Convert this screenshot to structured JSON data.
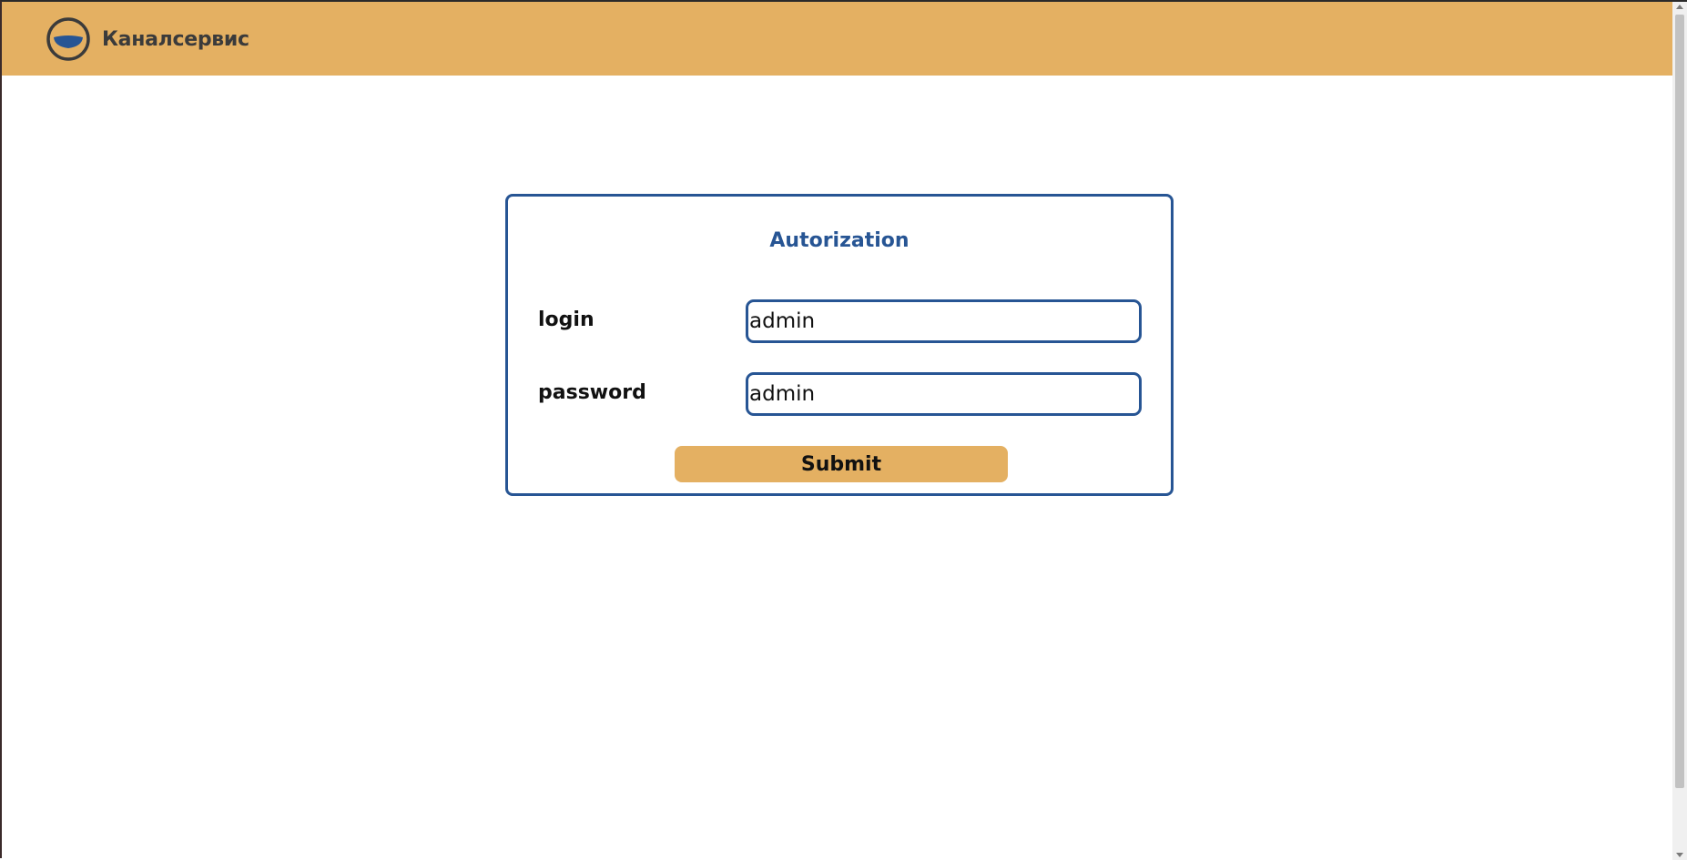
{
  "header": {
    "brand_name": "Каналсервис",
    "logo_icon": "water-bowl-icon",
    "background_color": "#e4b062"
  },
  "auth": {
    "title": "Autorization",
    "login_label": "login",
    "login_value": "admin",
    "password_label": "password",
    "password_value": "admin",
    "submit_label": "Submit"
  },
  "colors": {
    "accent": "#275594",
    "button": "#e4b062"
  }
}
